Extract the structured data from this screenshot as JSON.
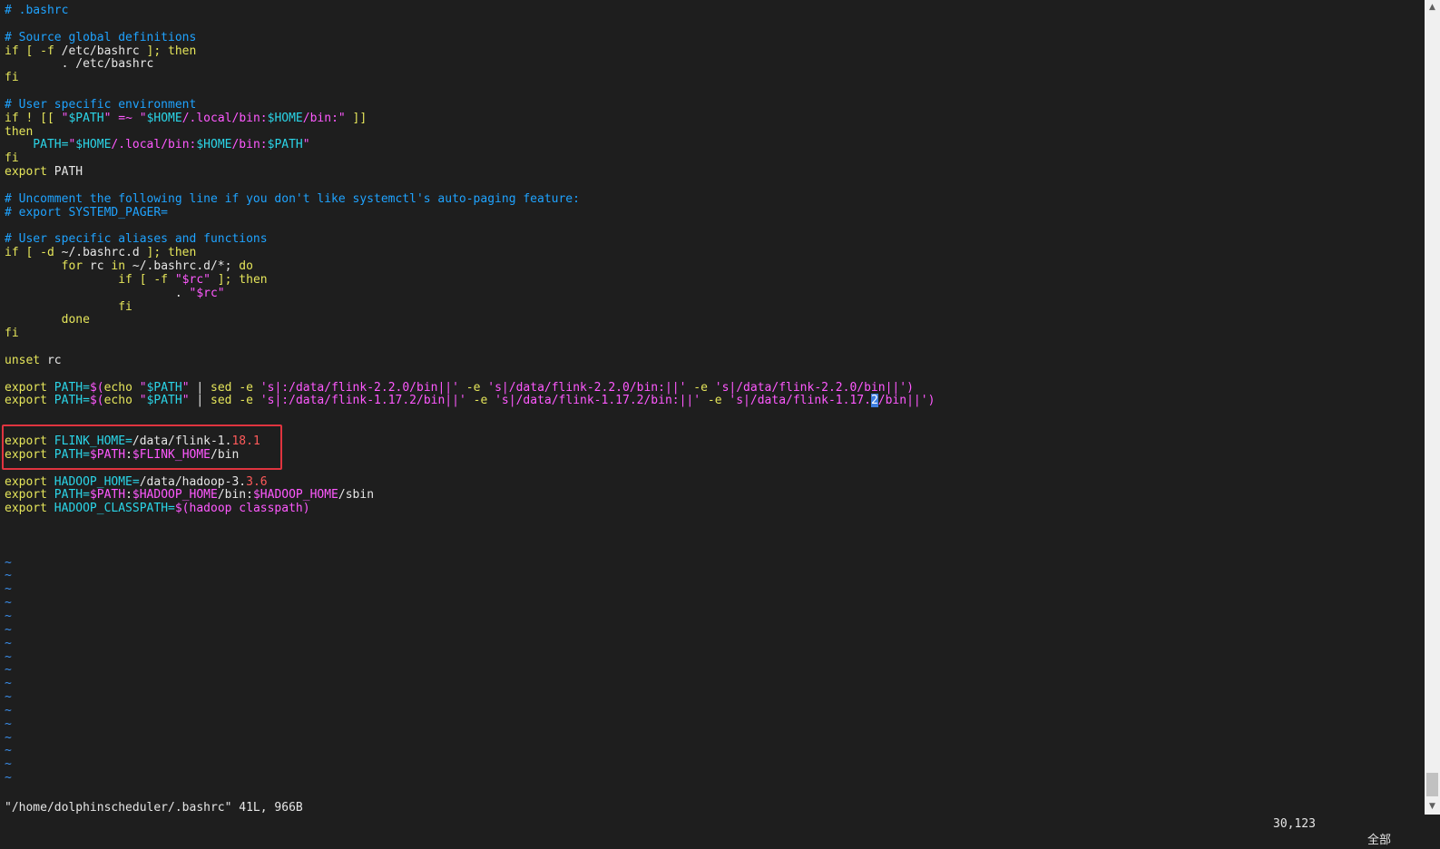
{
  "editor": {
    "lines": [
      [
        {
          "t": "# .bashrc",
          "c": "cm"
        }
      ],
      [],
      [
        {
          "t": "# Source global definitions",
          "c": "cm"
        }
      ],
      [
        {
          "t": "if [ -f ",
          "c": "kw"
        },
        {
          "t": "/etc/bashrc",
          "c": ""
        },
        {
          "t": " ]; then",
          "c": "kw"
        }
      ],
      [
        {
          "t": "        . /etc/bashrc",
          "c": ""
        }
      ],
      [
        {
          "t": "fi",
          "c": "kw"
        }
      ],
      [],
      [
        {
          "t": "# User specific environment",
          "c": "cm"
        }
      ],
      [
        {
          "t": "if ! [[ ",
          "c": "kw"
        },
        {
          "t": "\"",
          "c": "st"
        },
        {
          "t": "$PATH",
          "c": "vr"
        },
        {
          "t": "\" =~ \"",
          "c": "st"
        },
        {
          "t": "$HOME",
          "c": "vr"
        },
        {
          "t": "/.local/bin:",
          "c": "st"
        },
        {
          "t": "$HOME",
          "c": "vr"
        },
        {
          "t": "/bin:\"",
          "c": "st"
        },
        {
          "t": " ]]",
          "c": "kw"
        }
      ],
      [
        {
          "t": "then",
          "c": "kw"
        }
      ],
      [
        {
          "t": "    PATH=",
          "c": "vr"
        },
        {
          "t": "\"",
          "c": "st"
        },
        {
          "t": "$HOME",
          "c": "vr"
        },
        {
          "t": "/.local/bin:",
          "c": "st"
        },
        {
          "t": "$HOME",
          "c": "vr"
        },
        {
          "t": "/bin:",
          "c": "st"
        },
        {
          "t": "$PATH",
          "c": "vr"
        },
        {
          "t": "\"",
          "c": "st"
        }
      ],
      [
        {
          "t": "fi",
          "c": "kw"
        }
      ],
      [
        {
          "t": "export",
          "c": "kw"
        },
        {
          "t": " PATH",
          "c": ""
        }
      ],
      [],
      [
        {
          "t": "# Uncomment the following line if you don't like systemctl's auto-paging feature:",
          "c": "cm"
        }
      ],
      [
        {
          "t": "# export SYSTEMD_PAGER=",
          "c": "cm"
        }
      ],
      [],
      [
        {
          "t": "# User specific aliases and functions",
          "c": "cm"
        }
      ],
      [
        {
          "t": "if [ -d ",
          "c": "kw"
        },
        {
          "t": "~/.bashrc.d",
          "c": ""
        },
        {
          "t": " ]; then",
          "c": "kw"
        }
      ],
      [
        {
          "t": "        for",
          "c": "kw"
        },
        {
          "t": " rc ",
          "c": ""
        },
        {
          "t": "in",
          "c": "kw"
        },
        {
          "t": " ~/.bashrc.d/*; ",
          "c": ""
        },
        {
          "t": "do",
          "c": "kw"
        }
      ],
      [
        {
          "t": "                if [ -f ",
          "c": "kw"
        },
        {
          "t": "\"$rc\"",
          "c": "st"
        },
        {
          "t": " ]; then",
          "c": "kw"
        }
      ],
      [
        {
          "t": "                        . ",
          "c": ""
        },
        {
          "t": "\"$rc\"",
          "c": "st"
        }
      ],
      [
        {
          "t": "                fi",
          "c": "kw"
        }
      ],
      [
        {
          "t": "        done",
          "c": "kw"
        }
      ],
      [
        {
          "t": "fi",
          "c": "kw"
        }
      ],
      [],
      [
        {
          "t": "unset",
          "c": "kw"
        },
        {
          "t": " rc",
          "c": ""
        }
      ],
      [],
      [
        {
          "t": "export",
          "c": "kw"
        },
        {
          "t": " PATH=",
          "c": "vr"
        },
        {
          "t": "$(",
          "c": "st"
        },
        {
          "t": "echo ",
          "c": "kw"
        },
        {
          "t": "\"",
          "c": "st"
        },
        {
          "t": "$PATH",
          "c": "vr"
        },
        {
          "t": "\"",
          "c": "st"
        },
        {
          "t": " | ",
          "c": ""
        },
        {
          "t": "sed -e ",
          "c": "kw"
        },
        {
          "t": "'s|:/data/flink-2.2.0/bin||'",
          "c": "st"
        },
        {
          "t": " -e ",
          "c": "kw"
        },
        {
          "t": "'s|/data/flink-2.2.0/bin:||'",
          "c": "st"
        },
        {
          "t": " -e ",
          "c": "kw"
        },
        {
          "t": "'s|/data/flink-2.2.0/bin||')",
          "c": "st"
        }
      ],
      [
        {
          "t": "export",
          "c": "kw"
        },
        {
          "t": " PATH=",
          "c": "vr"
        },
        {
          "t": "$(",
          "c": "st"
        },
        {
          "t": "echo ",
          "c": "kw"
        },
        {
          "t": "\"",
          "c": "st"
        },
        {
          "t": "$PATH",
          "c": "vr"
        },
        {
          "t": "\"",
          "c": "st"
        },
        {
          "t": " | ",
          "c": ""
        },
        {
          "t": "sed -e ",
          "c": "kw"
        },
        {
          "t": "'s|:/data/flink-1.17.2/bin||'",
          "c": "st"
        },
        {
          "t": " -e ",
          "c": "kw"
        },
        {
          "t": "'s|/data/flink-1.17.2/bin:||'",
          "c": "st"
        },
        {
          "t": " -e ",
          "c": "kw"
        },
        {
          "t": "'s|/data/flink-1.17.",
          "c": "st"
        },
        {
          "t": "2",
          "c": "cr"
        },
        {
          "t": "/bin||')",
          "c": "st"
        }
      ],
      [],
      [],
      [
        {
          "t": "export",
          "c": "kw"
        },
        {
          "t": " FLINK_HOME=",
          "c": "vr"
        },
        {
          "t": "/data/flink-1.",
          "c": ""
        },
        {
          "t": "18.1",
          "c": "nm"
        }
      ],
      [
        {
          "t": "export",
          "c": "kw"
        },
        {
          "t": " PATH=",
          "c": "vr"
        },
        {
          "t": "$PATH",
          "c": "st"
        },
        {
          "t": ":",
          "c": ""
        },
        {
          "t": "$FLINK_HOME",
          "c": "st"
        },
        {
          "t": "/bin",
          "c": ""
        }
      ],
      [],
      [
        {
          "t": "export",
          "c": "kw"
        },
        {
          "t": " HADOOP_HOME=",
          "c": "vr"
        },
        {
          "t": "/data/hadoop-3.",
          "c": ""
        },
        {
          "t": "3.6",
          "c": "nm"
        }
      ],
      [
        {
          "t": "export",
          "c": "kw"
        },
        {
          "t": " PATH=",
          "c": "vr"
        },
        {
          "t": "$PATH",
          "c": "st"
        },
        {
          "t": ":",
          "c": ""
        },
        {
          "t": "$HADOOP_HOME",
          "c": "st"
        },
        {
          "t": "/bin:",
          "c": ""
        },
        {
          "t": "$HADOOP_HOME",
          "c": "st"
        },
        {
          "t": "/sbin",
          "c": ""
        }
      ],
      [
        {
          "t": "export",
          "c": "kw"
        },
        {
          "t": " HADOOP_CLASSPATH=",
          "c": "vr"
        },
        {
          "t": "$(hadoop classpath)",
          "c": "st"
        }
      ],
      [],
      [],
      [],
      [
        {
          "t": "~",
          "c": "tl"
        }
      ],
      [
        {
          "t": "~",
          "c": "tl"
        }
      ],
      [
        {
          "t": "~",
          "c": "tl"
        }
      ],
      [
        {
          "t": "~",
          "c": "tl"
        }
      ],
      [
        {
          "t": "~",
          "c": "tl"
        }
      ],
      [
        {
          "t": "~",
          "c": "tl"
        }
      ],
      [
        {
          "t": "~",
          "c": "tl"
        }
      ],
      [
        {
          "t": "~",
          "c": "tl"
        }
      ],
      [
        {
          "t": "~",
          "c": "tl"
        }
      ],
      [
        {
          "t": "~",
          "c": "tl"
        }
      ],
      [
        {
          "t": "~",
          "c": "tl"
        }
      ],
      [
        {
          "t": "~",
          "c": "tl"
        }
      ],
      [
        {
          "t": "~",
          "c": "tl"
        }
      ],
      [
        {
          "t": "~",
          "c": "tl"
        }
      ],
      [
        {
          "t": "~",
          "c": "tl"
        }
      ],
      [
        {
          "t": "~",
          "c": "tl"
        }
      ],
      [
        {
          "t": "~",
          "c": "tl"
        }
      ]
    ]
  },
  "status": {
    "file": "\"/home/dolphinscheduler/.bashrc\" 41L, 966B",
    "position": "30,123",
    "scroll": "全部"
  },
  "colors": {
    "background": "#1e1e1e",
    "comment": "#1fa3ff",
    "keyword": "#e5e55a",
    "string": "#ff59ff",
    "variable": "#2bd5e8",
    "number": "#ff5a5a",
    "highlight_box": "#e0343f"
  },
  "icons": {
    "scroll_up": "▲",
    "scroll_down": "▼"
  }
}
